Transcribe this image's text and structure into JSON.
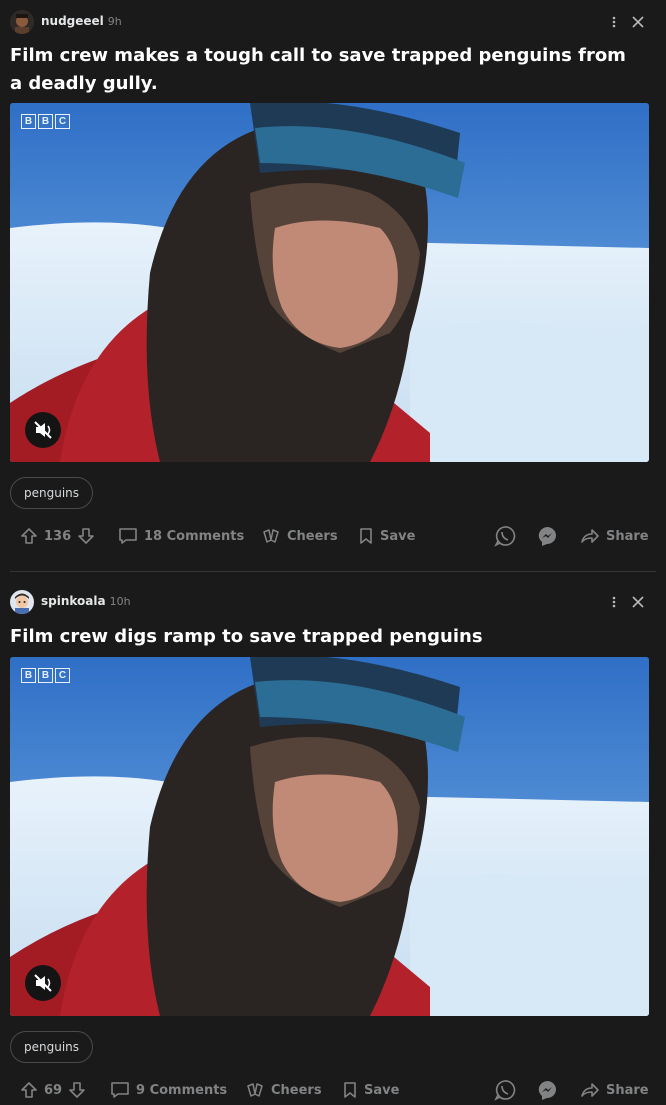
{
  "posts": [
    {
      "username": "nudgeeel",
      "age": "9h",
      "title": "Film crew makes a tough call to save trapped penguins from a deadly gully.",
      "media": {
        "logo": [
          "B",
          "B",
          "C"
        ],
        "muted": true
      },
      "flair": "penguins",
      "votes": "136",
      "comments": "18 Comments",
      "cheers": "Cheers",
      "save": "Save",
      "share": "Share"
    },
    {
      "username": "spinkoala",
      "age": "10h",
      "title": "Film crew digs ramp to save trapped penguins",
      "media": {
        "logo": [
          "B",
          "B",
          "C"
        ],
        "muted": true
      },
      "flair": "penguins",
      "votes": "69",
      "comments": "9 Comments",
      "cheers": "Cheers",
      "save": "Save",
      "share": "Share"
    }
  ],
  "colors": {
    "background": "#1a1a1b",
    "text": "#d7dadc",
    "muted_text": "#818384",
    "divider": "#343536"
  },
  "icons": [
    "more-vertical-icon",
    "close-icon",
    "mute-icon",
    "upvote-icon",
    "downvote-icon",
    "comment-icon",
    "cheers-icon",
    "bookmark-icon",
    "whatsapp-icon",
    "messenger-icon",
    "share-icon"
  ]
}
